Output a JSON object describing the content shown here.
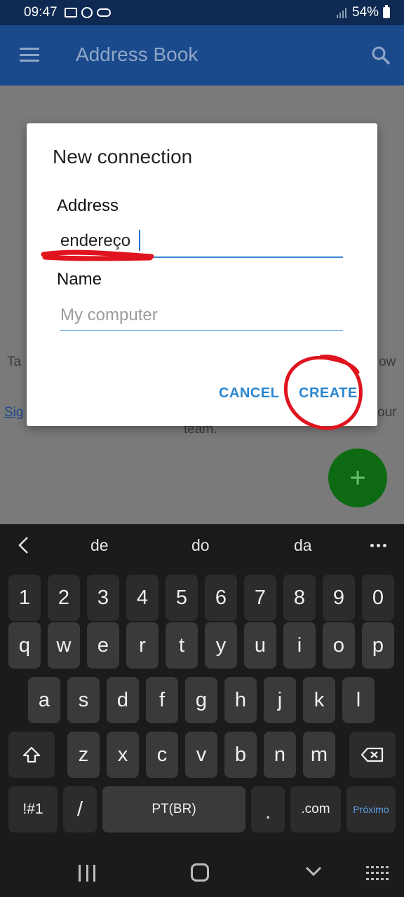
{
  "status_bar": {
    "time": "09:47",
    "battery": "54%",
    "icons": [
      "gallery-icon",
      "whatsapp-icon",
      "game-icon",
      "signal-icon",
      "battery-icon"
    ]
  },
  "app_bar": {
    "title": "Address Book",
    "icons": [
      "menu-icon",
      "search-icon"
    ]
  },
  "background": {
    "fragment_left_1": "Ta",
    "fragment_right_1": "ow",
    "link_fragment": "Sig",
    "fragment_right_2": "our",
    "fragment_center": "team.",
    "fab_label": "+"
  },
  "dialog": {
    "title": "New connection",
    "address_label": "Address",
    "address_value": "endereço",
    "name_label": "Name",
    "name_placeholder": "My computer",
    "cancel_label": "CANCEL",
    "create_label": "CREATE"
  },
  "keyboard": {
    "suggestions": [
      "de",
      "do",
      "da"
    ],
    "number_row": [
      "1",
      "2",
      "3",
      "4",
      "5",
      "6",
      "7",
      "8",
      "9",
      "0"
    ],
    "row1": [
      "q",
      "w",
      "e",
      "r",
      "t",
      "y",
      "u",
      "i",
      "o",
      "p"
    ],
    "row2": [
      "a",
      "s",
      "d",
      "f",
      "g",
      "h",
      "j",
      "k",
      "l"
    ],
    "row3": [
      "z",
      "x",
      "c",
      "v",
      "b",
      "n",
      "m"
    ],
    "symbols_key": "!#1",
    "slash_key": "/",
    "space_key": "PT(BR)",
    "period_key": ".",
    "dotcom_key": ".com",
    "next_key": "Próximo"
  },
  "colors": {
    "app_bar": "#1a4a8c",
    "status_bar": "#0e2a52",
    "accent": "#2a86d0",
    "fab": "#0d6a12",
    "annotation": "#e0141e"
  }
}
